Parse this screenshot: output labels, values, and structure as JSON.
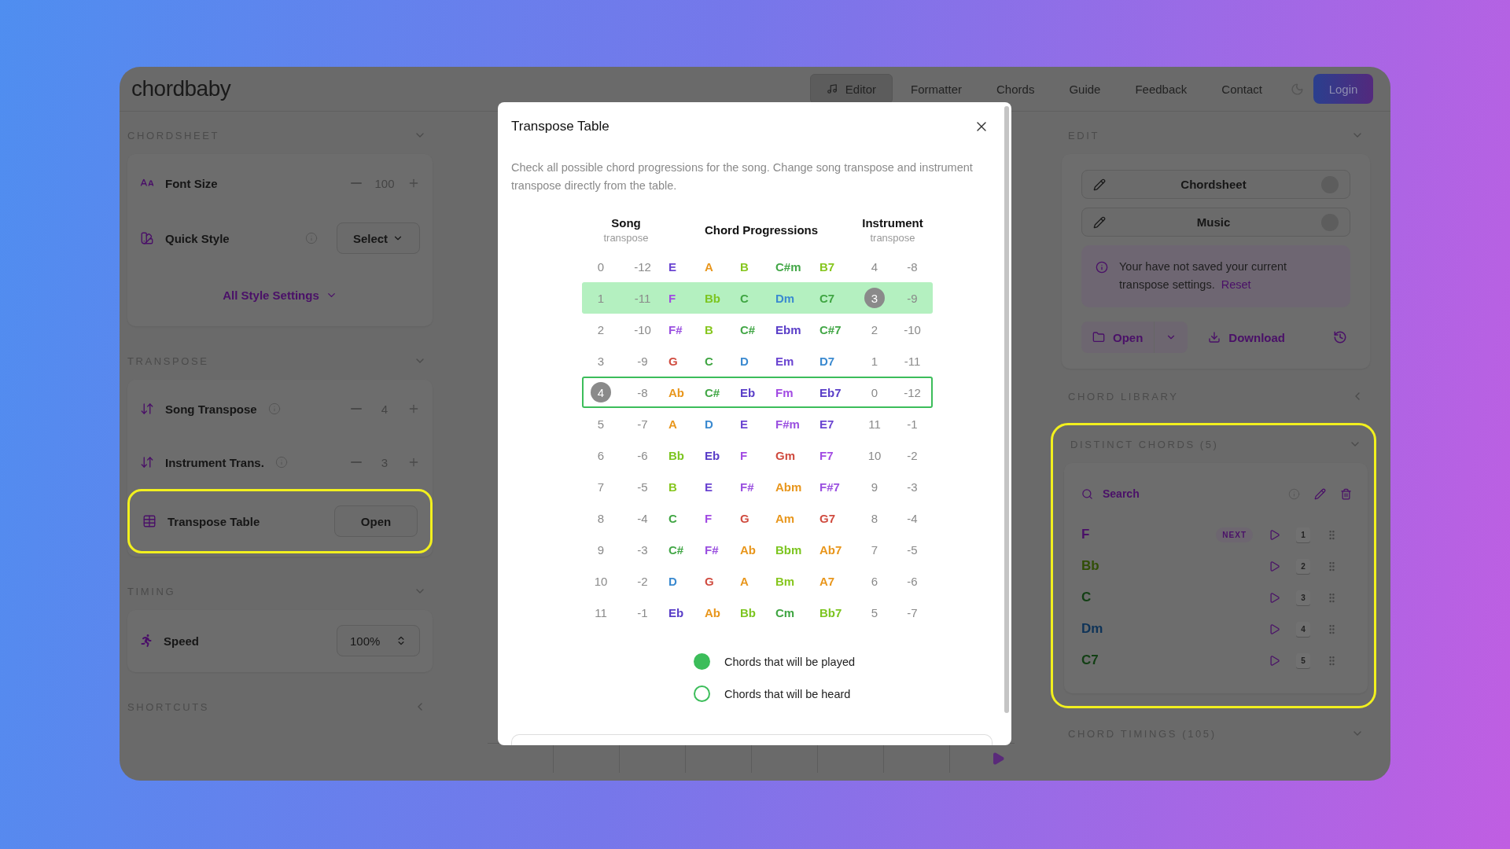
{
  "header": {
    "logo": "chordbaby",
    "nav": [
      {
        "label": "Editor",
        "selected": true
      },
      {
        "label": "Formatter",
        "selected": false
      },
      {
        "label": "Chords",
        "selected": false
      },
      {
        "label": "Guide",
        "selected": false
      },
      {
        "label": "Feedback",
        "selected": false
      },
      {
        "label": "Contact",
        "selected": false
      }
    ],
    "login": "Login"
  },
  "left_sidebar": [
    {
      "title": "CHORDSHEET",
      "expanded": true,
      "rows": [
        {
          "kind": "stepper",
          "label": "Font Size",
          "info": false,
          "value": "100"
        },
        {
          "kind": "select",
          "label": "Quick Style",
          "info": true,
          "value": "Select"
        },
        {
          "kind": "link",
          "label": "All Style Settings"
        }
      ]
    },
    {
      "title": "TRANSPOSE",
      "expanded": true,
      "rows": [
        {
          "kind": "stepper",
          "label": "Song Transpose",
          "info": true,
          "value": "4"
        },
        {
          "kind": "stepper",
          "label": "Instrument Trans.",
          "info": true,
          "value": "3"
        },
        {
          "kind": "button",
          "label": "Transpose Table",
          "value": "Open",
          "highlighted": true
        }
      ]
    },
    {
      "title": "TIMING",
      "expanded": true,
      "rows": [
        {
          "kind": "spin",
          "label": "Speed",
          "value": "100%"
        }
      ]
    },
    {
      "title": "SHORTCUTS",
      "expanded": false
    }
  ],
  "transpose_table": {
    "title": "Transpose Table",
    "description": "Check all possible chord progressions for the song. Change song transpose and instrument transpose directly from the table.",
    "columns": {
      "song": "Song",
      "song_sub": "transpose",
      "chords": "Chord Progressions",
      "instrument": "Instrument",
      "instrument_sub": "transpose"
    },
    "rows": [
      {
        "song": "0",
        "song_alt": "-12",
        "song_selected": false,
        "instrument": "4",
        "instrument_alt": "-8",
        "instrument_selected": false,
        "played": false,
        "heard": false,
        "chords": [
          {
            "name": "E",
            "color": "#6b45d1"
          },
          {
            "name": "A",
            "color": "#e8961c"
          },
          {
            "name": "B",
            "color": "#86c61e"
          },
          {
            "name": "C#m",
            "color": "#43a747"
          },
          {
            "name": "B7",
            "color": "#86c61e"
          }
        ]
      },
      {
        "song": "1",
        "song_alt": "-11",
        "song_selected": false,
        "instrument": "3",
        "instrument_alt": "-9",
        "instrument_selected": true,
        "played": true,
        "heard": false,
        "chords": [
          {
            "name": "F",
            "color": "#a24be3"
          },
          {
            "name": "Bb",
            "color": "#7cc520"
          },
          {
            "name": "C",
            "color": "#3fa542"
          },
          {
            "name": "Dm",
            "color": "#3b8ad0"
          },
          {
            "name": "C7",
            "color": "#3fa542"
          }
        ]
      },
      {
        "song": "2",
        "song_alt": "-10",
        "song_selected": false,
        "instrument": "2",
        "instrument_alt": "-10",
        "instrument_selected": false,
        "played": false,
        "heard": false,
        "chords": [
          {
            "name": "F#",
            "color": "#9b51e0"
          },
          {
            "name": "B",
            "color": "#86c61e"
          },
          {
            "name": "C#",
            "color": "#43a747"
          },
          {
            "name": "Ebm",
            "color": "#5a3ec8"
          },
          {
            "name": "C#7",
            "color": "#43a747"
          }
        ]
      },
      {
        "song": "3",
        "song_alt": "-9",
        "song_selected": false,
        "instrument": "1",
        "instrument_alt": "-11",
        "instrument_selected": false,
        "played": false,
        "heard": false,
        "chords": [
          {
            "name": "G",
            "color": "#d04b3f"
          },
          {
            "name": "C",
            "color": "#3fa542"
          },
          {
            "name": "D",
            "color": "#3b8ad0"
          },
          {
            "name": "Em",
            "color": "#6b45d1"
          },
          {
            "name": "D7",
            "color": "#3b8ad0"
          }
        ]
      },
      {
        "song": "4",
        "song_alt": "-8",
        "song_selected": true,
        "instrument": "0",
        "instrument_alt": "-12",
        "instrument_selected": false,
        "played": false,
        "heard": true,
        "chords": [
          {
            "name": "Ab",
            "color": "#e8961c"
          },
          {
            "name": "C#",
            "color": "#43a747"
          },
          {
            "name": "Eb",
            "color": "#5a3ec8"
          },
          {
            "name": "Fm",
            "color": "#a24be3"
          },
          {
            "name": "Eb7",
            "color": "#5a3ec8"
          }
        ]
      },
      {
        "song": "5",
        "song_alt": "-7",
        "song_selected": false,
        "instrument": "11",
        "instrument_alt": "-1",
        "instrument_selected": false,
        "played": false,
        "heard": false,
        "chords": [
          {
            "name": "A",
            "color": "#e8961c"
          },
          {
            "name": "D",
            "color": "#3b8ad0"
          },
          {
            "name": "E",
            "color": "#6b45d1"
          },
          {
            "name": "F#m",
            "color": "#9b51e0"
          },
          {
            "name": "E7",
            "color": "#6b45d1"
          }
        ]
      },
      {
        "song": "6",
        "song_alt": "-6",
        "song_selected": false,
        "instrument": "10",
        "instrument_alt": "-2",
        "instrument_selected": false,
        "played": false,
        "heard": false,
        "chords": [
          {
            "name": "Bb",
            "color": "#7cc520"
          },
          {
            "name": "Eb",
            "color": "#5a3ec8"
          },
          {
            "name": "F",
            "color": "#a24be3"
          },
          {
            "name": "Gm",
            "color": "#d04b3f"
          },
          {
            "name": "F7",
            "color": "#a24be3"
          }
        ]
      },
      {
        "song": "7",
        "song_alt": "-5",
        "song_selected": false,
        "instrument": "9",
        "instrument_alt": "-3",
        "instrument_selected": false,
        "played": false,
        "heard": false,
        "chords": [
          {
            "name": "B",
            "color": "#86c61e"
          },
          {
            "name": "E",
            "color": "#6b45d1"
          },
          {
            "name": "F#",
            "color": "#9b51e0"
          },
          {
            "name": "Abm",
            "color": "#e8961c"
          },
          {
            "name": "F#7",
            "color": "#9b51e0"
          }
        ]
      },
      {
        "song": "8",
        "song_alt": "-4",
        "song_selected": false,
        "instrument": "8",
        "instrument_alt": "-4",
        "instrument_selected": false,
        "played": false,
        "heard": false,
        "chords": [
          {
            "name": "C",
            "color": "#3fa542"
          },
          {
            "name": "F",
            "color": "#a24be3"
          },
          {
            "name": "G",
            "color": "#d04b3f"
          },
          {
            "name": "Am",
            "color": "#e8961c"
          },
          {
            "name": "G7",
            "color": "#d04b3f"
          }
        ]
      },
      {
        "song": "9",
        "song_alt": "-3",
        "song_selected": false,
        "instrument": "7",
        "instrument_alt": "-5",
        "instrument_selected": false,
        "played": false,
        "heard": false,
        "chords": [
          {
            "name": "C#",
            "color": "#43a747"
          },
          {
            "name": "F#",
            "color": "#9b51e0"
          },
          {
            "name": "Ab",
            "color": "#e8961c"
          },
          {
            "name": "Bbm",
            "color": "#7cc520"
          },
          {
            "name": "Ab7",
            "color": "#e8961c"
          }
        ]
      },
      {
        "song": "10",
        "song_alt": "-2",
        "song_selected": false,
        "instrument": "6",
        "instrument_alt": "-6",
        "instrument_selected": false,
        "played": false,
        "heard": false,
        "chords": [
          {
            "name": "D",
            "color": "#3b8ad0"
          },
          {
            "name": "G",
            "color": "#d04b3f"
          },
          {
            "name": "A",
            "color": "#e8961c"
          },
          {
            "name": "Bm",
            "color": "#86c61e"
          },
          {
            "name": "A7",
            "color": "#e8961c"
          }
        ]
      },
      {
        "song": "11",
        "song_alt": "-1",
        "song_selected": false,
        "instrument": "5",
        "instrument_alt": "-7",
        "instrument_selected": false,
        "played": false,
        "heard": false,
        "chords": [
          {
            "name": "Eb",
            "color": "#5a3ec8"
          },
          {
            "name": "Ab",
            "color": "#e8961c"
          },
          {
            "name": "Bb",
            "color": "#7cc520"
          },
          {
            "name": "Cm",
            "color": "#3fa542"
          },
          {
            "name": "Bb7",
            "color": "#7cc520"
          }
        ]
      }
    ],
    "legend": [
      {
        "kind": "filled",
        "label": "Chords that will be played"
      },
      {
        "kind": "outline",
        "label": "Chords that will be heard"
      }
    ]
  },
  "right_sidebar": {
    "edit": {
      "title": "EDIT",
      "expanded": true,
      "toggles": [
        {
          "label": "Chordsheet",
          "on": false
        },
        {
          "label": "Music",
          "on": false
        }
      ],
      "notice": "Your have not saved your current transpose settings.",
      "notice_link": "Reset",
      "open": "Open",
      "download": "Download"
    },
    "chord_library": {
      "title": "CHORD LIBRARY",
      "expanded": false
    },
    "distinct_chords": {
      "title": "DISTINCT CHORDS (5)",
      "expanded": true,
      "highlighted": true,
      "search_placeholder": "Search",
      "chords": [
        {
          "name": "F",
          "color": "#4a1068",
          "key": "1",
          "badge": "NEXT"
        },
        {
          "name": "Bb",
          "color": "#314e06",
          "key": "2"
        },
        {
          "name": "C",
          "color": "#123f14",
          "key": "3"
        },
        {
          "name": "Dm",
          "color": "#0e3358",
          "key": "4"
        },
        {
          "name": "C7",
          "color": "#123f14",
          "key": "5"
        }
      ]
    },
    "chord_timings": {
      "title": "CHORD TIMINGS (105)",
      "expanded": true
    }
  }
}
